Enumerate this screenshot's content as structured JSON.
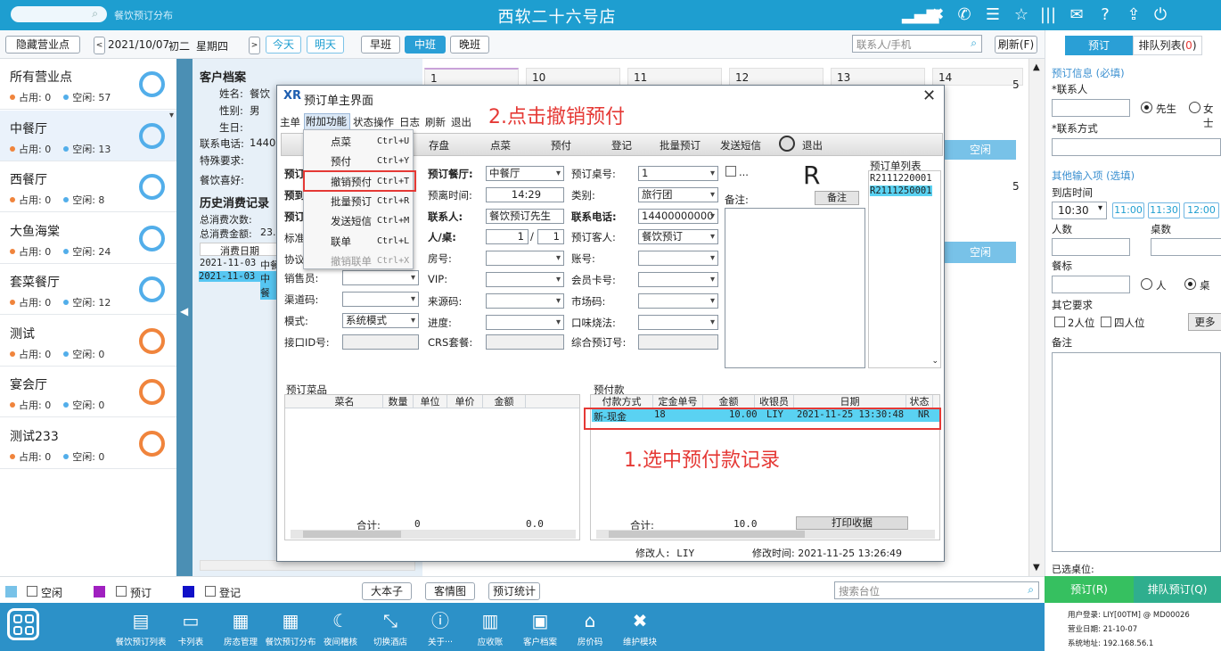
{
  "top": {
    "search_placeholder": "餐饮预订分布",
    "title": "西软二十六号店"
  },
  "toolbar": {
    "hide_btn": "隐藏营业点",
    "date": "2021/10/07",
    "lunar": "初二",
    "weekday": "星期四",
    "today": "今天",
    "tomorrow": "明天",
    "shifts": [
      "早班",
      "中班",
      "晚班"
    ],
    "contact_placeholder": "联系人/手机",
    "refresh": "刷新(F)"
  },
  "venues": [
    {
      "name": "所有营业点",
      "busy": "占用: 0",
      "free": "空闲: 57"
    },
    {
      "name": "中餐厅",
      "busy": "占用: 0",
      "free": "空闲: 13"
    },
    {
      "name": "西餐厅",
      "busy": "占用: 0",
      "free": "空闲: 8"
    },
    {
      "name": "大鱼海棠",
      "busy": "占用: 0",
      "free": "空闲: 24"
    },
    {
      "name": "套菜餐厅",
      "busy": "占用: 0",
      "free": "空闲: 12"
    },
    {
      "name": "测试",
      "busy": "占用: 0",
      "free": "空闲: 0"
    },
    {
      "name": "宴会厅",
      "busy": "占用: 0",
      "free": "空闲: 0"
    },
    {
      "name": "测试233",
      "busy": "占用: 0",
      "free": "空闲: 0"
    }
  ],
  "customer": {
    "heading": "客户档案",
    "name_label": "姓名:",
    "name_val": "餐饮",
    "gender_label": "性别:",
    "gender_val": "男",
    "birthday_label": "生日:",
    "phone_label": "联系电话:",
    "phone_val": "1440",
    "special_label": "特殊要求:",
    "pref_label": "餐饮喜好:",
    "history_heading": "历史消费记录",
    "count_label": "总消费次数:",
    "amount_label": "总消费金额:",
    "amount_val": "23.",
    "col_date": "消费日期",
    "rows": [
      {
        "date": "2021-11-03",
        "v": "中餐"
      },
      {
        "date": "2021-11-03",
        "v": "中餐"
      }
    ]
  },
  "bg": {
    "tile_nums": [
      "1",
      "10",
      "11",
      "12",
      "13",
      "14"
    ],
    "right_nums": [
      "5",
      "5",
      "5"
    ],
    "free": "空闲"
  },
  "right": {
    "tab_book": "预订",
    "tab_queue": "排队列表(",
    "tab_queue_count": "0",
    "tab_queue_end": ")",
    "info_title": "预订信息 (必填)",
    "contact": "*联系人",
    "mr": "先生",
    "ms": "女士",
    "contact_method": "*联系方式",
    "other_title": "其他输入项 (选填)",
    "arrive": "到店时间",
    "time_val": "10:30",
    "times": [
      "11:00",
      "11:30",
      "12:00"
    ],
    "people": "人数",
    "tables": "桌数",
    "std": "餐标",
    "per_person": "人",
    "per_table": "桌",
    "other_req": "其它要求",
    "two": "2人位",
    "four": "四人位",
    "more": "更多",
    "remark": "备注",
    "selected": "已选桌位:",
    "book_btn": "预订(R)",
    "queue_btn": "排队预订(Q)"
  },
  "legend": {
    "free": "空闲",
    "book": "预订",
    "reg": "登记",
    "big": "大本子",
    "situation": "客情图",
    "stats": "预订统计",
    "search_placeholder": "搜索台位"
  },
  "dock": [
    "餐饮预订列表",
    "卡列表",
    "房态管理",
    "餐饮预订分布",
    "夜间稽核",
    "切换酒店",
    "关于···",
    "应收账",
    "客户档案",
    "房价码",
    "维护模块"
  ],
  "dockinfo": {
    "user": "用户登录: LIY[00TM] @ MD00026",
    "date": "营业日期: 21-10-07",
    "ip": "系统地址: 192.168.56.1"
  },
  "dialog": {
    "title": "预订单主界面",
    "menubar": [
      "主单",
      "附加功能",
      "状态操作",
      "日志",
      "刷新",
      "退出"
    ],
    "tb": [
      "存盘",
      "点菜",
      "预付",
      "登记",
      "批量预订",
      "发送短信",
      "退出"
    ],
    "menu": [
      {
        "l": "点菜",
        "s": "Ctrl+U"
      },
      {
        "l": "预付",
        "s": "Ctrl+Y"
      },
      {
        "l": "撤销预付",
        "s": "Ctrl+T"
      },
      {
        "l": "批量预订",
        "s": "Ctrl+R"
      },
      {
        "l": "发送短信",
        "s": "Ctrl+M"
      },
      {
        "l": "联单",
        "s": "Ctrl+L"
      },
      {
        "l": "撤销联单",
        "s": "Ctrl+X"
      }
    ],
    "f": {
      "restaurant_l": "预订餐厅:",
      "restaurant_v": "中餐厅",
      "table_l": "预订桌号:",
      "table_v": "1",
      "leave_l": "预离时间:",
      "leave_v": "14:29",
      "cat_l": "类别:",
      "cat_v": "旅行团",
      "contact_l": "联系人:",
      "contact_v": "餐饮预订先生",
      "phone_l": "联系电话:",
      "phone_v": "14400000000",
      "ppt_l": "人/桌:",
      "ppt_v1": "1",
      "ppt_sep": "/",
      "ppt_v2": "1",
      "guest_l": "预订客人:",
      "guest_v": "餐饮预订",
      "room_l": "房号:",
      "acct_l": "账号:",
      "vip_l": "VIP:",
      "card_l": "会员卡号:",
      "src_l": "来源码:",
      "mkt_l": "市场码:",
      "prog_l": "进度:",
      "taste_l": "口味烧法:",
      "crs_l": "CRS套餐:",
      "combo_l": "综合预订号:",
      "sales_l": "销售员:",
      "channel_l": "渠道码:",
      "mode_l": "模式:",
      "mode_v": "系统模式",
      "iface_l": "接口ID号:",
      "ellipsis": "...",
      "big_r": "R",
      "remark_l": "备注:",
      "remark_btn": "备注",
      "list_l": "预订单列表",
      "list": [
        "R2111220001",
        "R2111250001"
      ],
      "left_cut": [
        "预订",
        "预到",
        "预订",
        "标准",
        "协议"
      ]
    },
    "dishes": {
      "title": "预订菜品",
      "cols": [
        "菜名",
        "数量",
        "单位",
        "单价",
        "金额"
      ],
      "total_l": "合计:",
      "total_q": "0",
      "total_a": "0.0"
    },
    "prepay": {
      "title": "预付款",
      "cols": [
        "付款方式",
        "定金单号",
        "金额",
        "收银员",
        "日期",
        "状态"
      ],
      "row": [
        "新-现金",
        "18",
        "10.00",
        "LIY",
        "2021-11-25 13:30:48",
        "NR"
      ],
      "total_l": "合计:",
      "total_a": "10.0",
      "print": "打印收据"
    },
    "footer": {
      "modifier": "修改人: LIY",
      "mtime": "修改时间: 2021-11-25 13:26:49"
    }
  },
  "annotations": {
    "step1": "1.选中预付款记录",
    "step2": "2.点击撤销预付"
  }
}
